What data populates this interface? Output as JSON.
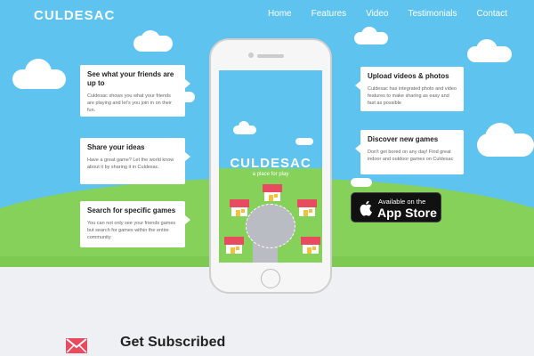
{
  "header": {
    "logo": "CULDESAC",
    "nav": [
      "Home",
      "Features",
      "Video",
      "Testimonials",
      "Contact"
    ]
  },
  "features_left": [
    {
      "title": "See what your friends are up to",
      "body": "Culdesac shows you what your friends are playing and let's you join in on their fun."
    },
    {
      "title": "Share your ideas",
      "body": "Have a great game? Let the world know about it by sharing it in Culdesac."
    },
    {
      "title": "Search for specific games",
      "body": "You can not only see your friends games but search for games within the entire community"
    }
  ],
  "features_right": [
    {
      "title": "Upload videos & photos",
      "body": "Culdesac has integrated photo and video features to make sharing as easy and fast as possible"
    },
    {
      "title": "Discover new games",
      "body": "Don't get bored on any day! Find great indoor and outdoor games on Culdesac"
    }
  ],
  "phone_app": {
    "title": "CULDESAC",
    "tagline": "a place for play"
  },
  "appstore": {
    "small": "Available on the",
    "big": "App Store"
  },
  "subscribe": {
    "title": "Get Subscribed"
  },
  "colors": {
    "sky": "#5ec4ef",
    "grass": "#86d15a",
    "roof": "#e84a5f",
    "accent": "#e84a5f"
  }
}
